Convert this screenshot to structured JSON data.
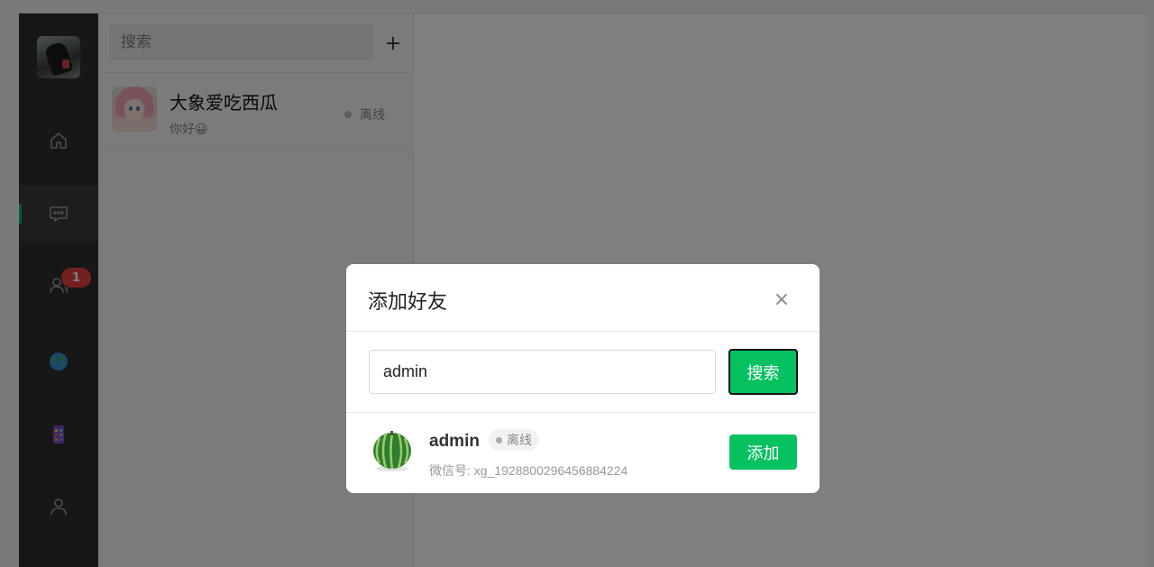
{
  "sidebar": {
    "unread_contacts_badge": "1"
  },
  "chat_list": {
    "search_placeholder": "搜索",
    "add_label": "+",
    "items": [
      {
        "name": "大象爱吃西瓜",
        "preview": "你好😀",
        "status": "离线"
      }
    ]
  },
  "modal": {
    "title": "添加好友",
    "close_label": "×",
    "search_value": "admin",
    "search_button": "搜索",
    "result": {
      "name": "admin",
      "status": "离线",
      "wxid": "微信号: xg_1928800296456884224",
      "add_button": "添加"
    }
  },
  "colors": {
    "accent": "#07c160",
    "badge": "#e64340",
    "sidebar_bg": "#2e2e2e"
  },
  "icons": [
    "home-icon",
    "chat-icon",
    "contacts-icon",
    "globe-icon",
    "apps-icon",
    "user-icon",
    "close-icon",
    "plus-icon"
  ]
}
